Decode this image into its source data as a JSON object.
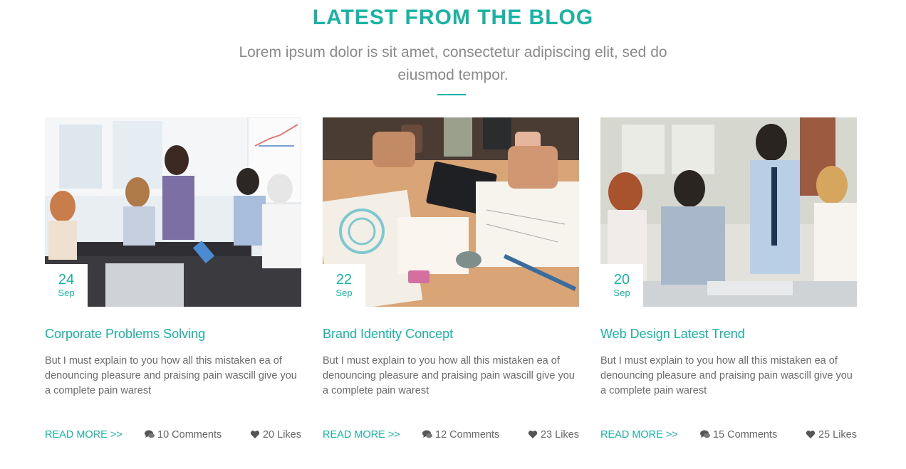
{
  "section": {
    "title": "LATEST FROM THE BLOG",
    "subtitle": "Lorem ipsum dolor is sit amet, consectetur adipiscing elit, sed do eiusmod tempor."
  },
  "colors": {
    "accent": "#17b3a3",
    "text": "#6a6a6a"
  },
  "posts": [
    {
      "day": "24",
      "month": "Sep",
      "title": "Corporate Problems Solving",
      "excerpt": "But I must explain to you how all this mistaken ea of denouncing pleasure and praising pain wascill give you a complete pain warest",
      "read_more": "READ MORE >>",
      "comments": "10 Comments",
      "likes": "20 Likes",
      "comment_icon": "comments-icon",
      "like_icon": "heart-icon"
    },
    {
      "day": "22",
      "month": "Sep",
      "title": "Brand Identity Concept",
      "excerpt": "But I must explain to you how all this mistaken ea of denouncing pleasure and praising pain wascill give you a complete pain warest",
      "read_more": "READ MORE >>",
      "comments": "12 Comments",
      "likes": "23 Likes",
      "comment_icon": "comments-icon",
      "like_icon": "heart-icon"
    },
    {
      "day": "20",
      "month": "Sep",
      "title": "Web Design Latest Trend",
      "excerpt": "But I must explain to you how all this mistaken ea of denouncing pleasure and praising pain wascill give you a complete pain warest",
      "read_more": "READ MORE >>",
      "comments": "15 Comments",
      "likes": "25 Likes",
      "comment_icon": "comments-icon",
      "like_icon": "heart-icon"
    }
  ]
}
